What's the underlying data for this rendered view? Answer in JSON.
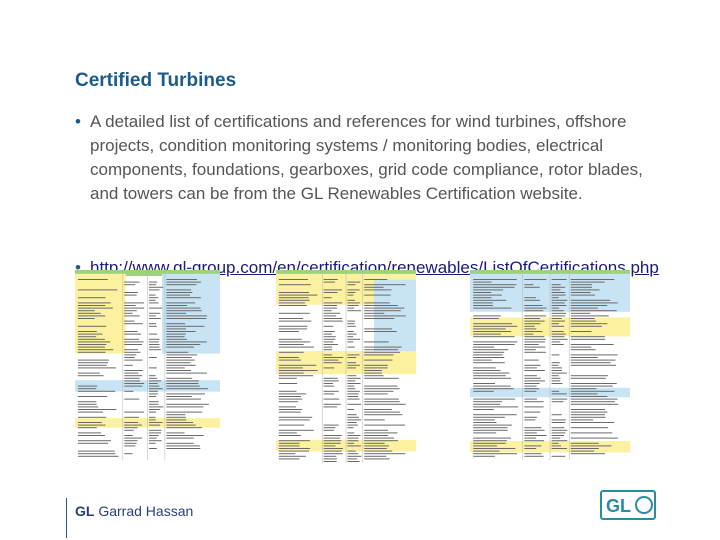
{
  "slide": {
    "title": "Certified Turbines",
    "bullet_text": "A detailed list of certifications and references for wind turbines, offshore projects, condition monitoring systems / monitoring bodies, electrical components, foundations, gearboxes, grid code compliance, rotor blades, and towers can be from the GL Renewables Certification website.",
    "link_text": "http://www.gl-group.com/en/certification/renewables/ListOfCertifications.php"
  },
  "footer": {
    "brand_bold": "GL",
    "brand_rest": " Garrad Hassan",
    "logo_text": "GL"
  },
  "colors": {
    "title": "#1d5a8a",
    "table_yellow": "#fbf1a0",
    "table_blue": "#c8e4f4",
    "table_green": "#9bd27a",
    "logo_teal": "#2a8ca0"
  }
}
